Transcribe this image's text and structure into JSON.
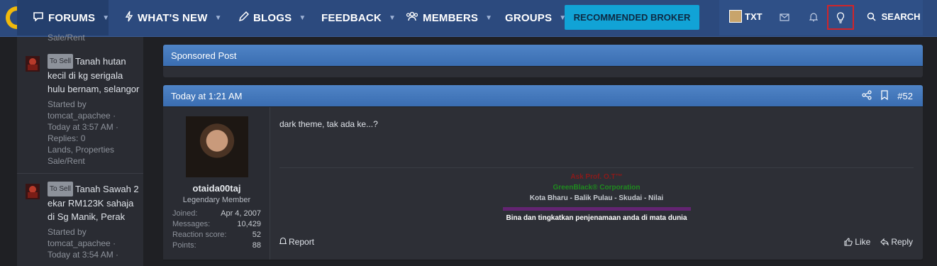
{
  "nav": {
    "forums": "FORUMS",
    "whats_new": "WHAT'S NEW",
    "blogs": "BLOGS",
    "feedback": "FEEDBACK",
    "members": "MEMBERS",
    "groups": "GROUPS",
    "broker": "RECOMMENDED BROKER",
    "user": "TXT",
    "search": "SEARCH",
    "caret": "▼"
  },
  "sidebar": {
    "top_fragment": "Sale/Rent",
    "threads": [
      {
        "tag": "To Sell",
        "title": "Tanah hutan kecil di kg serigala hulu bernam, selangor",
        "meta_started": "Started by tomcat_apachee ·",
        "meta_time": "Today at 3:57 AM ·",
        "meta_replies": "Replies: 0",
        "meta_forum": "Lands, Properties Sale/Rent"
      },
      {
        "tag": "To Sell",
        "title": "Tanah Sawah 2 ekar RM123K sahaja di Sg Manik, Perak",
        "meta_started": "Started by tomcat_apachee ·",
        "meta_time": "Today at 3:54 AM ·"
      }
    ]
  },
  "sponsored": {
    "title": "Sponsored Post"
  },
  "post": {
    "time": "Today at 1:21 AM",
    "number": "#52",
    "author": {
      "name": "otaida00taj",
      "title": "Legendary Member",
      "stats": [
        {
          "label": "Joined:",
          "value": "Apr 4, 2007"
        },
        {
          "label": "Messages:",
          "value": "10,429"
        },
        {
          "label": "Reaction score:",
          "value": "52"
        },
        {
          "label": "Points:",
          "value": "88"
        }
      ]
    },
    "message": "dark theme, tak ada ke...?",
    "signature": {
      "line1": "Ask Prof. O.T™",
      "line2": "GreenBlack® Corporation",
      "line3": "Kota Bharu - Balik Pulau - Skudai - Nilai",
      "line5": "Bina dan tingkatkan penjenamaan anda di mata dunia"
    },
    "report": "Report",
    "like": "Like",
    "reply": "Reply"
  },
  "colors": {
    "nav_bg": "#2c4a7e",
    "accent": "#11a3d6",
    "sig_red": "#8b1a1a",
    "sig_green": "#1f8a1f",
    "sig_purple": "#7a1f8b",
    "highlight": "#d0252a"
  }
}
